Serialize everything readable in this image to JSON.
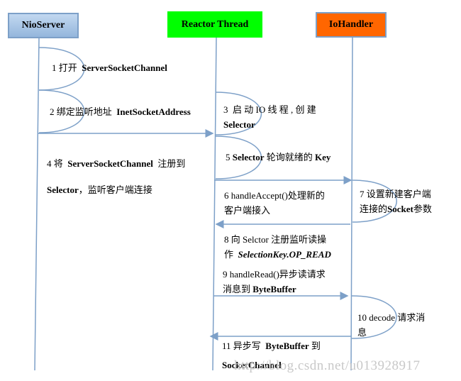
{
  "participants": [
    {
      "name": "NioServer",
      "color": "#a6c4e6"
    },
    {
      "name": "Reactor Thread",
      "color": "#00ff00"
    },
    {
      "name": "IoHandler",
      "color": "#ff6600"
    }
  ],
  "messages": [
    {
      "n": "1",
      "text": "打开",
      "bold": "ServerSocketChannel"
    },
    {
      "n": "2",
      "text": "绑定监听地址",
      "bold": "InetSocketAddress"
    },
    {
      "n": "3",
      "text": "启 动 IO 线 程 , 创 建",
      "bold": "Selector"
    },
    {
      "n": "4",
      "text": "将",
      "bold": "ServerSocketChannel",
      "text2": "注册到",
      "bold2": "Selector",
      "text3": "，监听客户端连接"
    },
    {
      "n": "5",
      "bold": "Selector",
      "text": "轮询就绪的",
      "bold2": "Key"
    },
    {
      "n": "6",
      "text": "handleAccept()处理新的",
      "text2": "客户端接入"
    },
    {
      "n": "7",
      "text": "设置新建客户端",
      "text2": "连接的",
      "bold": "Socket",
      "text3": "参数"
    },
    {
      "n": "8",
      "text": "向 Selctor 注册监听读操",
      "text2": "作",
      "italic": "SelectionKey.OP_READ"
    },
    {
      "n": "9",
      "text": "handleRead()异步读请求",
      "text2": "消息到",
      "bold": "ByteBuffer"
    },
    {
      "n": "10",
      "text": "decode  请求消",
      "text2": "息"
    },
    {
      "n": "11",
      "text": "异步写",
      "bold": "ByteBuffer",
      "text2": "到",
      "bold2": "SocketChannel"
    }
  ],
  "watermark": "http://blog.csdn.net/u013928917",
  "line_color": "#7da0c8"
}
